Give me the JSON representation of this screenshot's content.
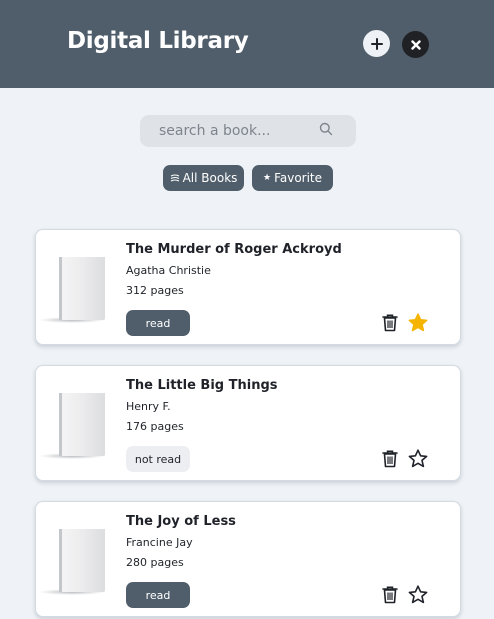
{
  "header": {
    "title": "Digital Library",
    "add_icon": "plus-icon",
    "close_icon": "close-icon",
    "background": "#505e6b"
  },
  "search": {
    "placeholder": "search a book...",
    "value": "",
    "icon": "search-icon"
  },
  "filters": [
    {
      "label": "All Books",
      "icon": "books-icon"
    },
    {
      "label": "Favorite",
      "icon": "star-icon"
    }
  ],
  "books": [
    {
      "title": "The Murder of Roger Ackroyd",
      "author": "Agatha Christie",
      "pages": "312 pages",
      "status": "read",
      "favorite": true
    },
    {
      "title": "The Little Big Things",
      "author": "Henry F.",
      "pages": "176 pages",
      "status": "not read",
      "favorite": false
    },
    {
      "title": "The Joy of Less",
      "author": "Francine Jay",
      "pages": "280 pages",
      "status": "read",
      "favorite": false
    }
  ],
  "colors": {
    "accent": "#505e6b",
    "favorite_star": "#f5b400",
    "page_bg": "#eff3f7"
  }
}
